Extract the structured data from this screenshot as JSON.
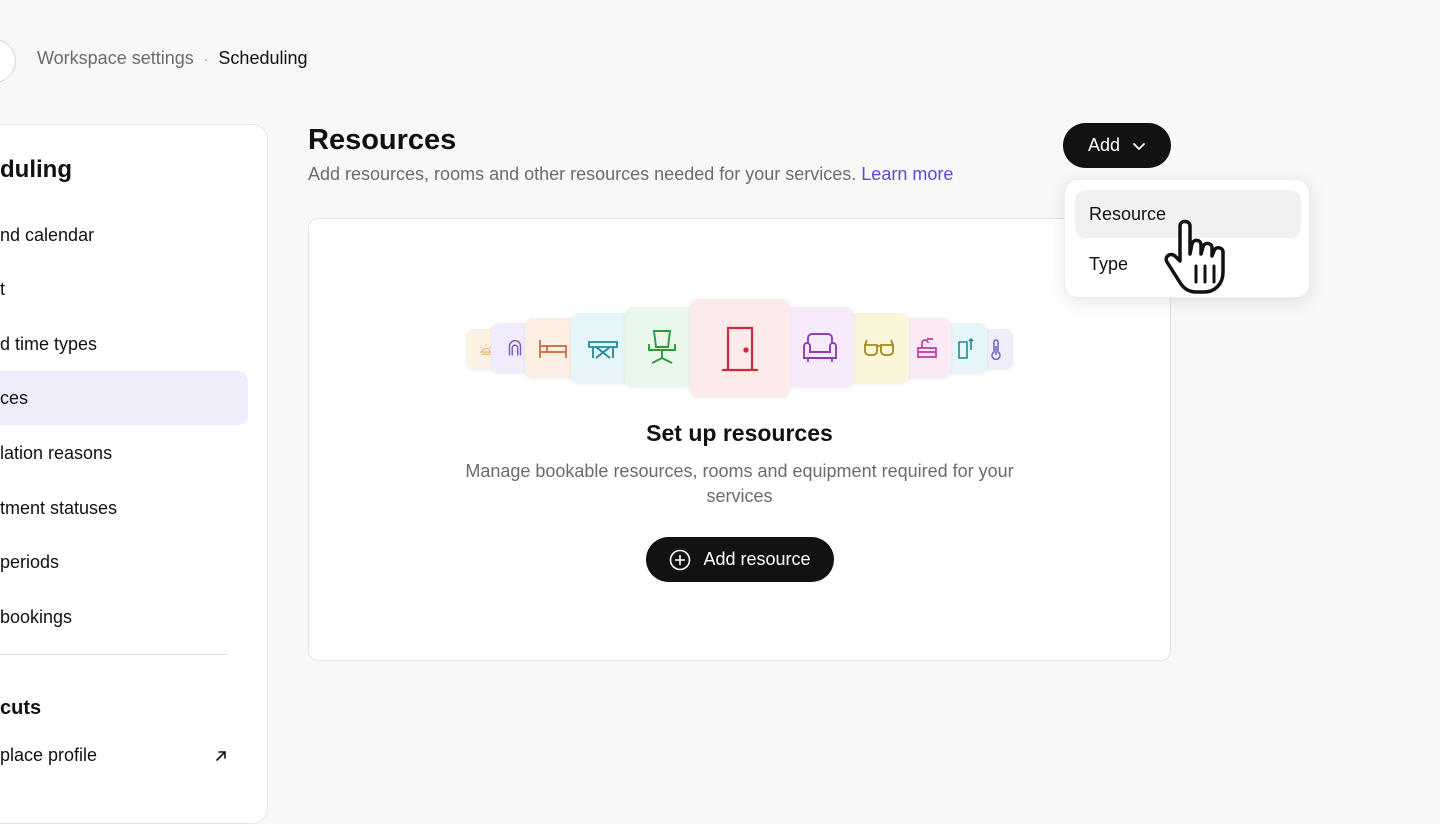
{
  "breadcrumb": {
    "parent": "Workspace settings",
    "separator": "·",
    "current": "Scheduling"
  },
  "sidebar": {
    "title": "duling",
    "items": [
      {
        "label": "nd calendar",
        "active": false
      },
      {
        "label": "t",
        "active": false
      },
      {
        "label": "d time types",
        "active": false
      },
      {
        "label": "ces",
        "active": true
      },
      {
        "label": "lation reasons",
        "active": false
      },
      {
        "label": "tment statuses",
        "active": false
      },
      {
        "label": " periods",
        "active": false
      },
      {
        "label": "bookings",
        "active": false
      }
    ],
    "section_title": "cuts",
    "link": {
      "label": "place profile",
      "icon": "arrow-up-right-icon"
    }
  },
  "header": {
    "title": "Resources",
    "subtitle": "Add resources, rooms and other resources needed for your services.",
    "learn_more": "Learn more"
  },
  "add_button": {
    "label": "Add",
    "icon": "chevron-down-icon"
  },
  "dropdown": {
    "items": [
      "Resource",
      "Type"
    ]
  },
  "empty_state": {
    "title": "Set up resources",
    "description": "Manage bookable resources, rooms and equipment required for your services",
    "button_label": "Add resource",
    "button_icon": "plus-circle-icon",
    "tiles": [
      {
        "icon": "sun-icon",
        "color": "#e6b97a",
        "bg": "#fdf3e4"
      },
      {
        "icon": "hair-dryer-icon",
        "color": "#7b5cc4",
        "bg": "#f1ecfb"
      },
      {
        "icon": "bed-icon",
        "color": "#c26a3a",
        "bg": "#fdeee4"
      },
      {
        "icon": "massage-table-icon",
        "color": "#1f8a9a",
        "bg": "#e6f6f8"
      },
      {
        "icon": "office-chair-icon",
        "color": "#2f9a3c",
        "bg": "#e9f7ea"
      },
      {
        "icon": "door-icon",
        "color": "#d2293a",
        "bg": "#fdebec"
      },
      {
        "icon": "armchair-icon",
        "color": "#8b3fb0",
        "bg": "#f6eafb"
      },
      {
        "icon": "glasses-icon",
        "color": "#a08a18",
        "bg": "#fbf5d9"
      },
      {
        "icon": "basin-icon",
        "color": "#c0399a",
        "bg": "#fbe9f5"
      },
      {
        "icon": "device-icon",
        "color": "#1f8a9a",
        "bg": "#e6f6f8"
      },
      {
        "icon": "thermometer-icon",
        "color": "#7b5cc4",
        "bg": "#f0edfb"
      }
    ]
  },
  "cursor": {
    "icon": "hand-pointer-icon"
  }
}
